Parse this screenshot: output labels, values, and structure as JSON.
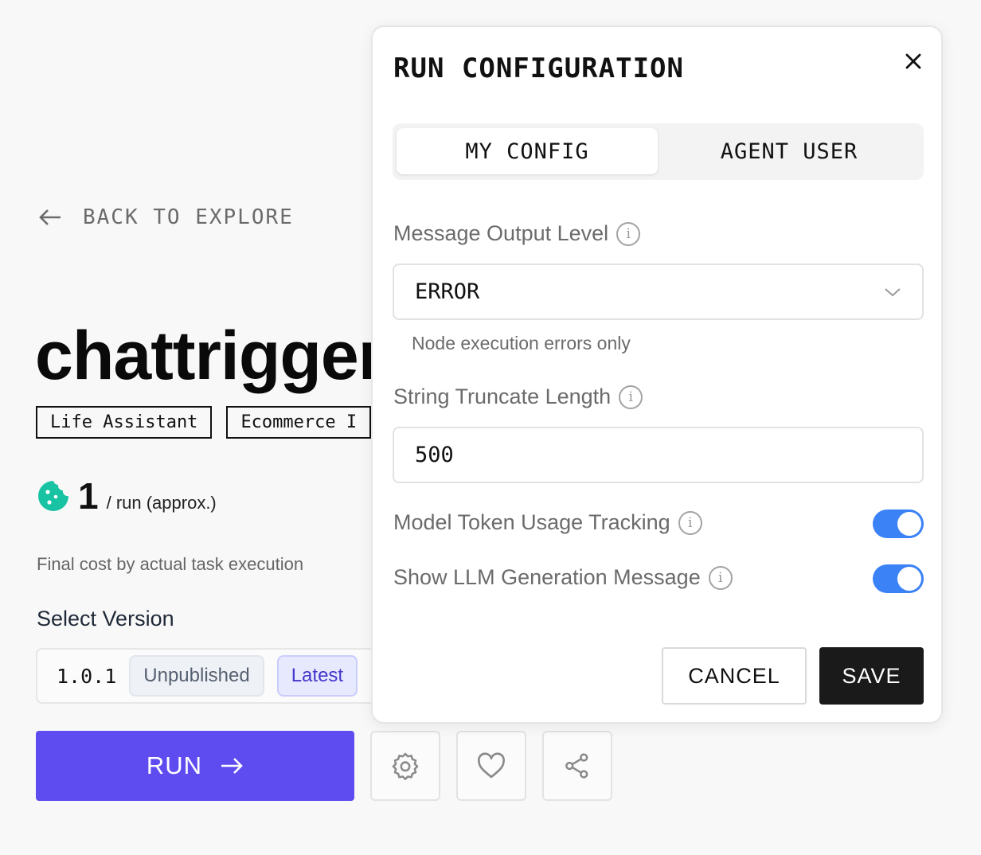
{
  "page": {
    "back_label": "BACK TO EXPLORE",
    "agent_name": "chattrigger",
    "tags": [
      "Life Assistant",
      "Ecommerce I"
    ],
    "cost": {
      "amount": "1",
      "unit": "/ run (approx.)",
      "note": "Final cost by actual task execution"
    },
    "version": {
      "label": "Select Version",
      "number": "1.0.1",
      "badges": {
        "unpublished": "Unpublished",
        "latest": "Latest"
      }
    },
    "run_label": "RUN",
    "action_icons": [
      "settings-icon",
      "heart-icon",
      "share-icon"
    ]
  },
  "modal": {
    "title": "RUN CONFIGURATION",
    "tabs": [
      {
        "label": "MY CONFIG",
        "active": true
      },
      {
        "label": "AGENT USER",
        "active": false
      }
    ],
    "output_level": {
      "label": "Message Output Level",
      "value": "ERROR",
      "helper": "Node execution errors only"
    },
    "truncate": {
      "label": "String Truncate Length",
      "value": "500"
    },
    "token_tracking": {
      "label": "Model Token Usage Tracking",
      "enabled": true
    },
    "llm_message": {
      "label": "Show LLM Generation Message",
      "enabled": true
    },
    "cancel_label": "CANCEL",
    "save_label": "SAVE"
  },
  "colors": {
    "run_button": "#5e4cf0",
    "toggle_on": "#3b82f6",
    "save_button": "#1a1a1a",
    "latest_badge_text": "#4338ca",
    "cost_icon": "#17c3a2"
  }
}
